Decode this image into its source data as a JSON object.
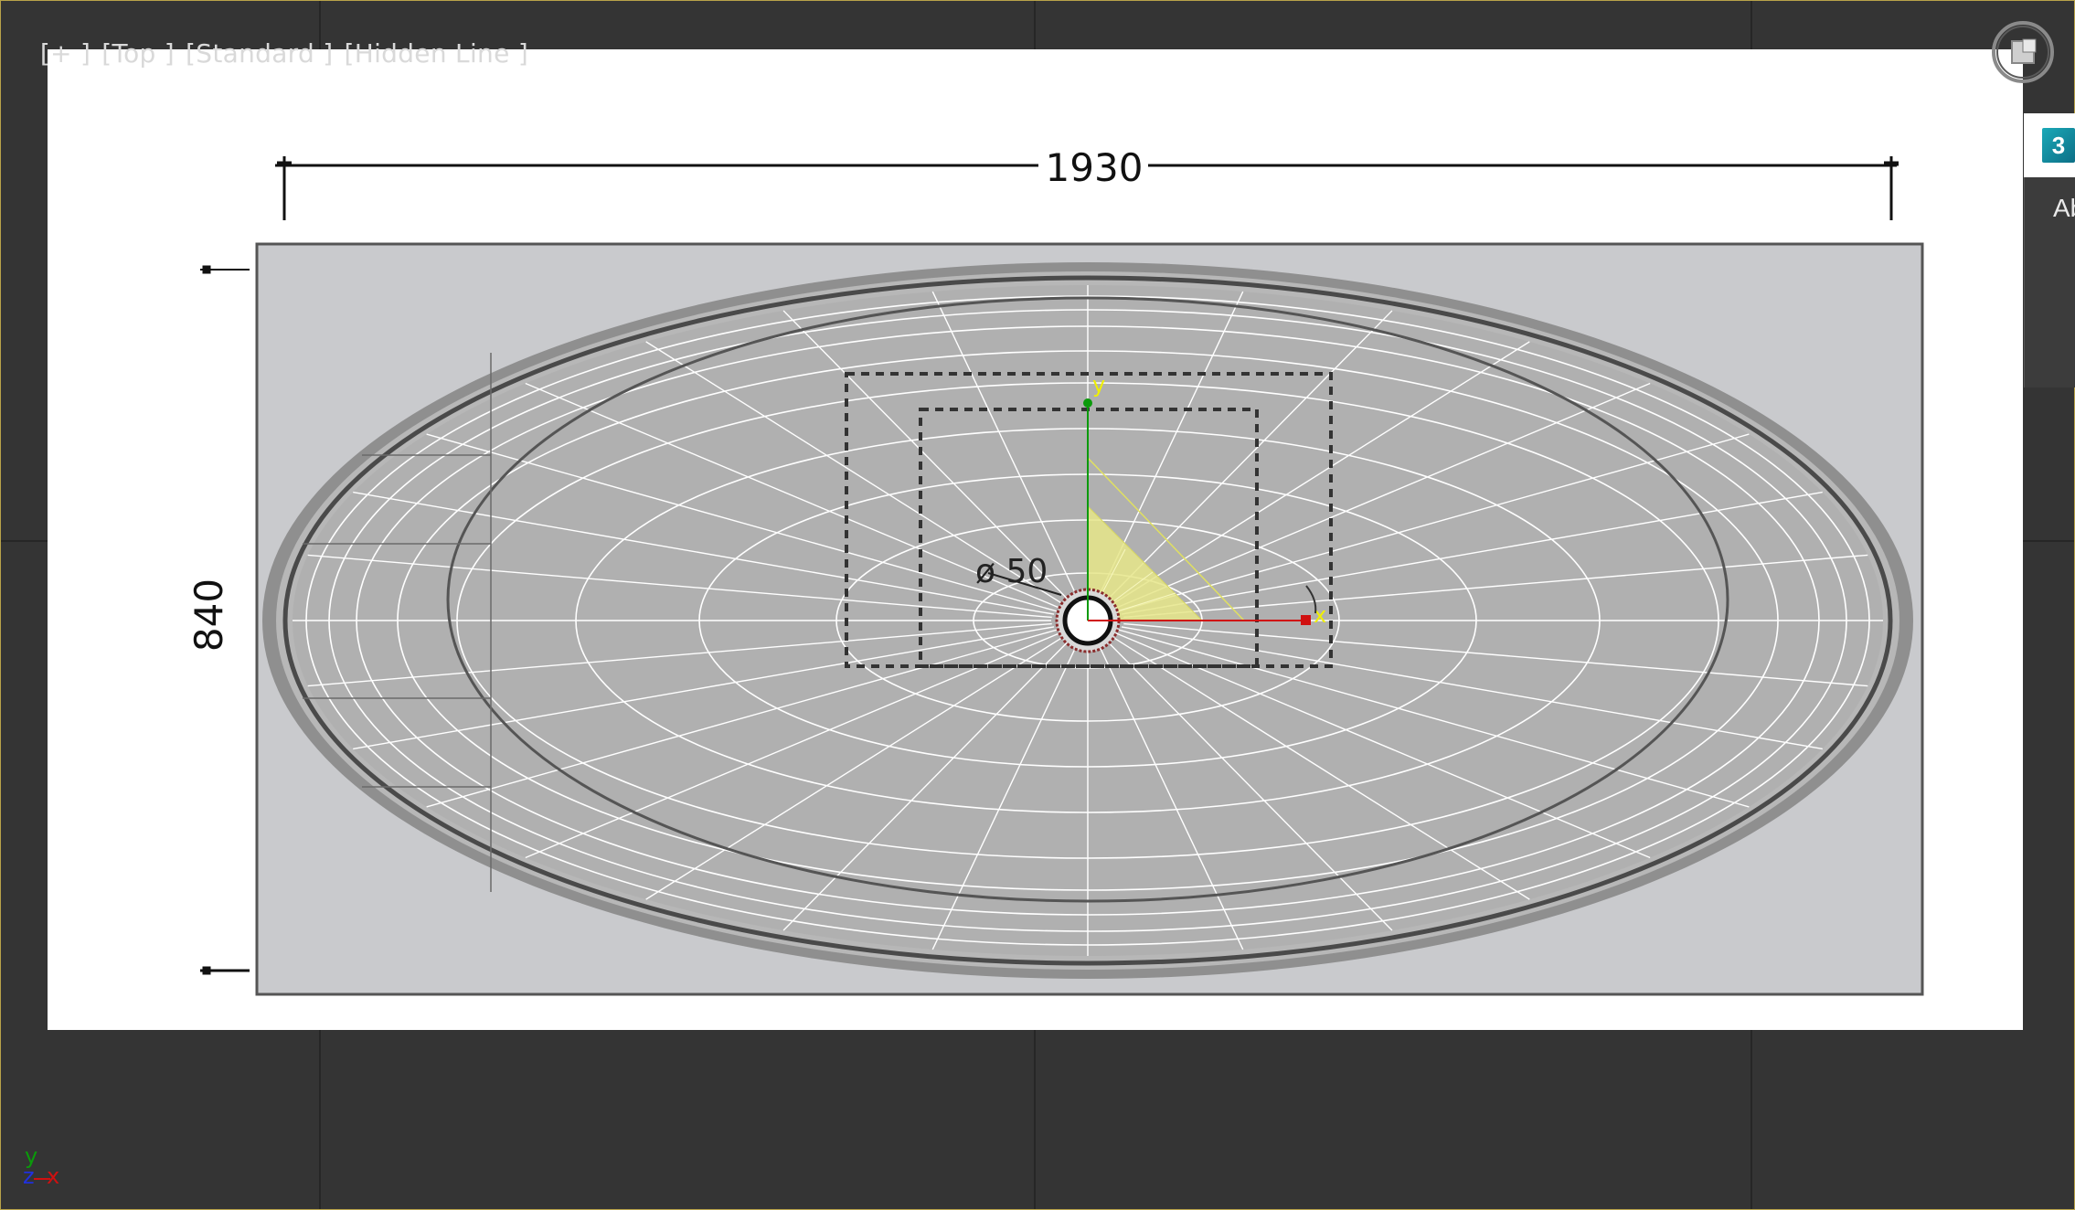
{
  "viewport": {
    "menu_label": "[+ ]",
    "view_label": "[Top ]",
    "mode_label": "[Standard ]",
    "shading_label": "[Hidden Line ]"
  },
  "drawing": {
    "width_dimension": "1930",
    "height_dimension": "840",
    "drain_label": "ø 50"
  },
  "gizmo": {
    "y_axis_label": "y",
    "x_axis_label": "x"
  },
  "side_panel": {
    "logo_text": "3",
    "partial_text": "Ab"
  },
  "axis_tripod": {
    "y": "y",
    "z": "z",
    "x": "x"
  },
  "colors": {
    "viewport_bg": "#343434",
    "border_accent": "#b8a34a",
    "axis_x": "#d01010",
    "axis_y": "#0a9a0a",
    "axis_z": "#2030e0",
    "gizmo_yellow": "#f0f000"
  }
}
